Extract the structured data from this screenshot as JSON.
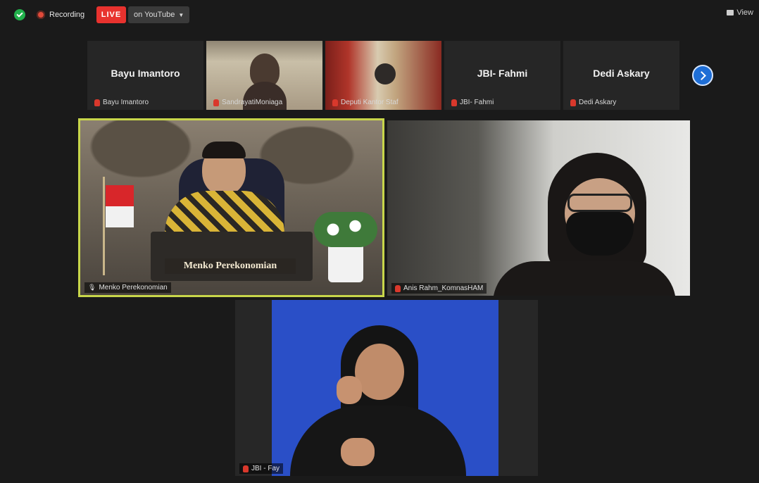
{
  "topbar": {
    "recording_label": "Recording",
    "live_label": "LIVE",
    "stream_label": "on YouTube",
    "view_label": "View"
  },
  "strip": {
    "thumbs": [
      {
        "big_name": "Bayu Imantoro",
        "small_name": "Bayu Imantoro"
      },
      {
        "big_name": "",
        "small_name": "SandrayatiMoniaga"
      },
      {
        "big_name": "",
        "small_name": "Deputi Kantor Staf"
      },
      {
        "big_name": "JBI- Fahmi",
        "small_name": "JBI- Fahmi"
      },
      {
        "big_name": "Dedi Askary",
        "small_name": "Dedi Askary"
      }
    ]
  },
  "tiles": {
    "tile1": {
      "label": "Menko Perekonomian",
      "banner": "Menko Perekonomian"
    },
    "tile2": {
      "label": "Anis Rahm_KomnasHAM"
    },
    "tile3": {
      "label": "JBI - Fay"
    }
  },
  "colors": {
    "live": "#e8322e",
    "active_speaker": "#c8d64a",
    "next_button": "#1e6ed6",
    "sign_background": "#2a4fc7"
  }
}
